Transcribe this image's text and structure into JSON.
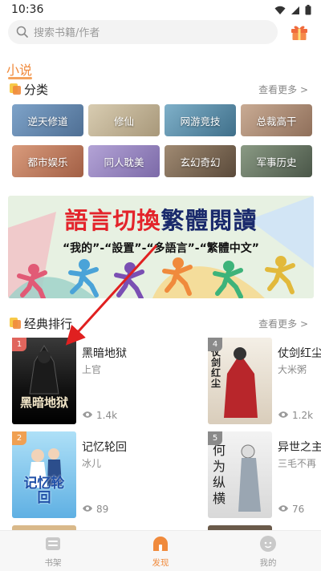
{
  "status": {
    "time": "10:36"
  },
  "search": {
    "placeholder": "搜索书籍/作者"
  },
  "header": {
    "category_tab": "小说"
  },
  "genres": {
    "title": "分类",
    "more": "查看更多 >",
    "items": [
      {
        "label": "逆天修道",
        "color": "#6b8fb8"
      },
      {
        "label": "修仙",
        "color": "#c7b99c"
      },
      {
        "label": "网游竞技",
        "color": "#6d9ab5"
      },
      {
        "label": "总裁高干",
        "color": "#b79a83"
      },
      {
        "label": "都市娱乐",
        "color": "#c98a70"
      },
      {
        "label": "同人耽美",
        "color": "#9f8fc3"
      },
      {
        "label": "玄幻奇幻",
        "color": "#8a7a6a"
      },
      {
        "label": "军事历史",
        "color": "#6f7a6a"
      }
    ]
  },
  "banner": {
    "headline_part1": "語言切換",
    "headline_part2": "繁體閱讀",
    "subline": "“我的”-“設置”-“多語言”-“繁體中文”"
  },
  "ranking": {
    "title": "经典排行",
    "more": "查看更多 >",
    "books": [
      {
        "rank": "1",
        "title": "黑暗地狱",
        "author": "上官",
        "views": "1.4k",
        "cover_text": "黑暗地狱",
        "rank_color": "#e0655d"
      },
      {
        "rank": "2",
        "title": "记忆轮回",
        "author": "冰儿",
        "views": "89",
        "cover_text": "记忆轮回",
        "rank_color": "#f0a052"
      },
      {
        "rank": "4",
        "title": "仗剑红尘",
        "author": "大米粥",
        "views": "1.2k",
        "cover_text": "仗剑红尘",
        "rank_color": "#8a8a8a"
      },
      {
        "rank": "5",
        "title": "异世之主",
        "author": "三毛不再",
        "views": "76",
        "cover_text": "何为纵横",
        "rank_color": "#8a8a8a"
      }
    ]
  },
  "nav": {
    "items": [
      {
        "label": "书架"
      },
      {
        "label": "发现"
      },
      {
        "label": "我的"
      }
    ],
    "active_color": "#f08a3c"
  }
}
